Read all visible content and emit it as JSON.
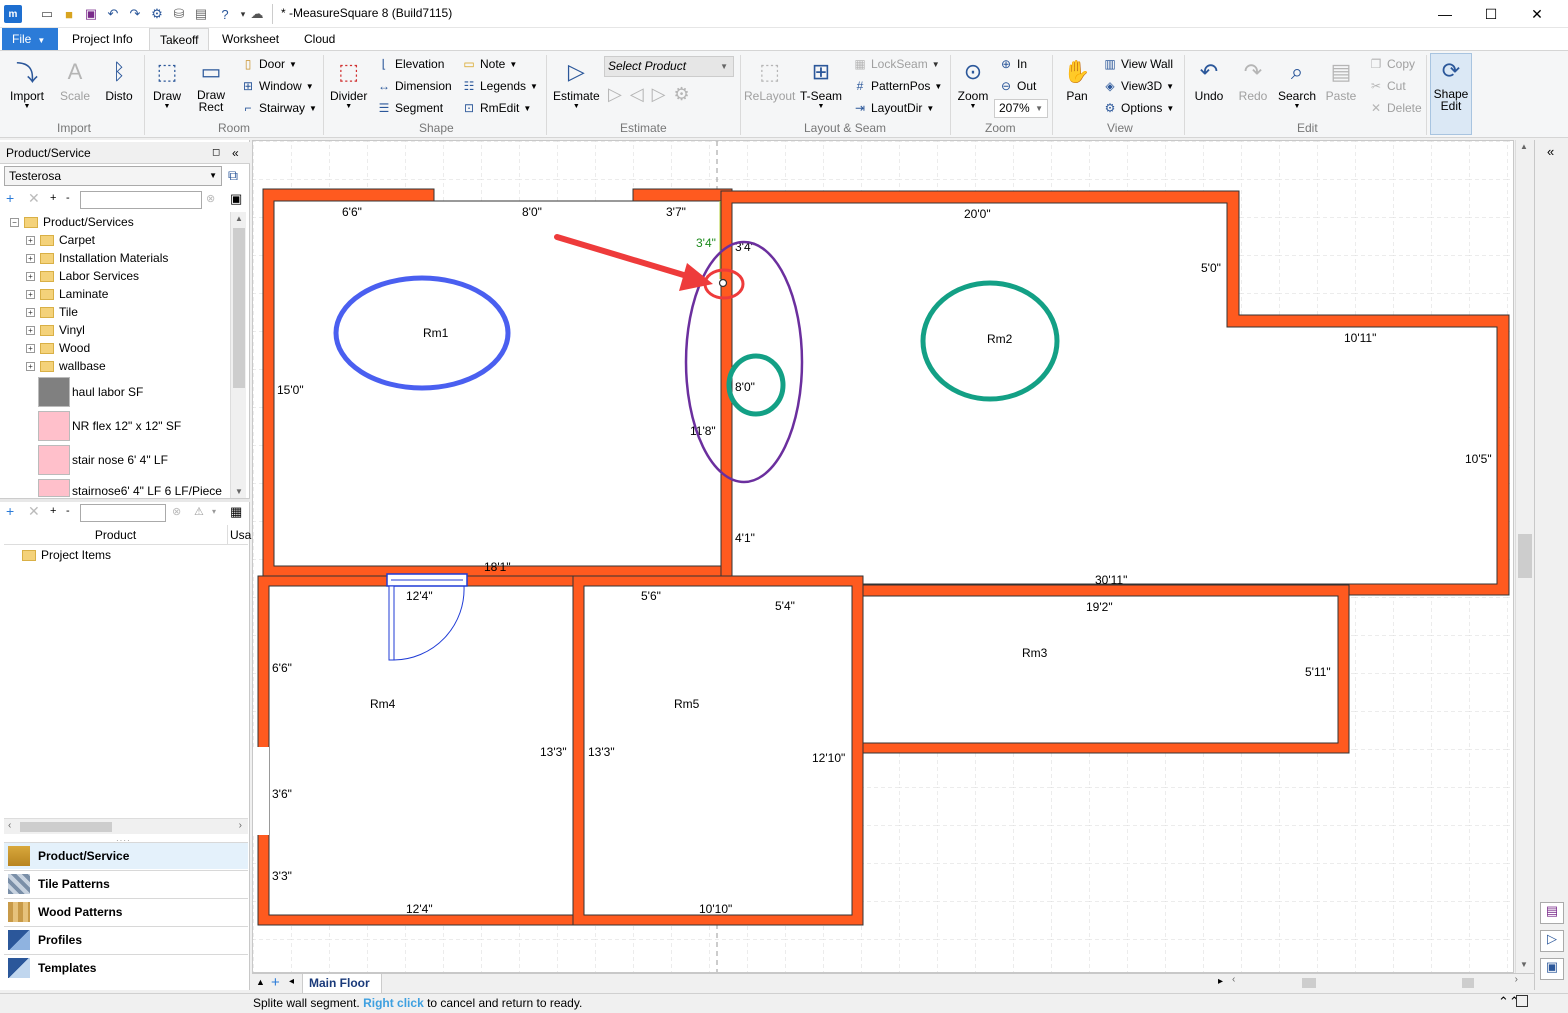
{
  "window": {
    "title": "* -MeasureSquare 8 (Build7115)",
    "minimize_icon": "minimize-icon",
    "maximize_icon": "maximize-icon",
    "close_icon": "close-icon"
  },
  "menu_tabs": [
    "File",
    "Project Info",
    "Takeoff",
    "Worksheet",
    "Cloud"
  ],
  "active_tab": "Takeoff",
  "ribbon": {
    "import": {
      "label": "Import",
      "scale": "Scale",
      "disto": "Disto",
      "group": "Import"
    },
    "room": {
      "draw": "Draw",
      "draw_rect": "Draw\nRect",
      "door": "Door",
      "window": "Window",
      "stairway": "Stairway",
      "group": "Room"
    },
    "shape": {
      "divider": "Divider",
      "elevation": "Elevation",
      "dimension": "Dimension",
      "segment": "Segment",
      "note": "Note",
      "legends": "Legends",
      "rmedit": "RmEdit",
      "group": "Shape"
    },
    "estimate": {
      "estimate": "Estimate",
      "select_product": "Select Product",
      "group": "Estimate"
    },
    "layout_seam": {
      "relayout": "ReLayout",
      "tseam": "T-Seam",
      "lockseam": "LockSeam",
      "patternpos": "PatternPos",
      "layoutdir": "LayoutDir",
      "group": "Layout & Seam"
    },
    "zoom": {
      "zoom": "Zoom",
      "in": "In",
      "out": "Out",
      "level": "207%",
      "group": "Zoom"
    },
    "view": {
      "pan": "Pan",
      "view_wall": "View Wall",
      "view3d": "View3D",
      "options": "Options",
      "group": "View"
    },
    "edit": {
      "undo": "Undo",
      "redo": "Redo",
      "search": "Search",
      "paste": "Paste",
      "copy": "Copy",
      "cut": "Cut",
      "delete": "Delete",
      "group": "Edit"
    },
    "shape_edit": {
      "label": "Shape\nEdit"
    }
  },
  "left_panel": {
    "header": "Product/Service",
    "selected_store": "Testerosa",
    "tree_root": "Product/Services",
    "categories": [
      "Carpet",
      "Installation Materials",
      "Labor Services",
      "Laminate",
      "Tile",
      "Vinyl",
      "Wood",
      "wallbase"
    ],
    "products": [
      {
        "label": "haul labor  SF",
        "color": "#808080"
      },
      {
        "label": "NR flex 12\" x 12\" SF",
        "color": "#ffc0cb"
      },
      {
        "label": "stair nose 6' 4\" LF",
        "color": "#ffc0cb"
      },
      {
        "label": "stairnose6' 4\" LF 6 LF/Piece",
        "color": "#ffc0cb"
      }
    ],
    "project_columns": [
      "Product",
      "Usa"
    ],
    "project_root": "Project Items",
    "bottom_tabs": [
      "Product/Service",
      "Tile Patterns",
      "Wood Patterns",
      "Profiles",
      "Templates"
    ]
  },
  "canvas": {
    "rooms": [
      "Rm1",
      "Rm2",
      "Rm3",
      "Rm4",
      "Rm5"
    ],
    "dimensions": {
      "rm1_top_a": "6'6\"",
      "rm1_top_b": "8'0\"",
      "rm1_top_c": "3'7\"",
      "rm1_left": "15'0\"",
      "rm1_right_green": "3'4\"",
      "rm1_right": "11'8\"",
      "rm1_bottom": "18'1\"",
      "rm2_top": "20'0\"",
      "rm2_notch": "5'0\"",
      "rm2_step": "10'11\"",
      "rm2_right": "10'5\"",
      "rm2_bottom": "30'11\"",
      "rm2_left_a": "3'4\"",
      "rm2_left_b": "8'0\"",
      "rm2_left_c": "4'1\"",
      "rm3_top": "19'2\"",
      "rm3_right": "5'11\"",
      "rm3_left": "12'10\"",
      "rm3_top_small": "5'4\"",
      "rm4_top": "12'4\"",
      "rm4_left_a": "6'6\"",
      "rm4_left_b": "3'6\"",
      "rm4_left_c": "3'3\"",
      "rm4_right": "13'3\"",
      "rm4_bottom": "12'4\"",
      "rm5_top": "5'6\"",
      "rm5_left": "13'3\"",
      "rm5_bottom": "10'10\""
    },
    "annotation_colors": {
      "wall": "#ff5a1f",
      "blue_ring": "#4a5ff0",
      "teal_ring": "#13a085",
      "purple_ring": "#6b2f9e",
      "red_arrow": "#ee3b3b"
    }
  },
  "floor_tabs": {
    "active": "Main Floor"
  },
  "status": {
    "text_before": "Splite wall segment. ",
    "link": "Right click",
    "text_after": " to cancel and return to ready."
  }
}
